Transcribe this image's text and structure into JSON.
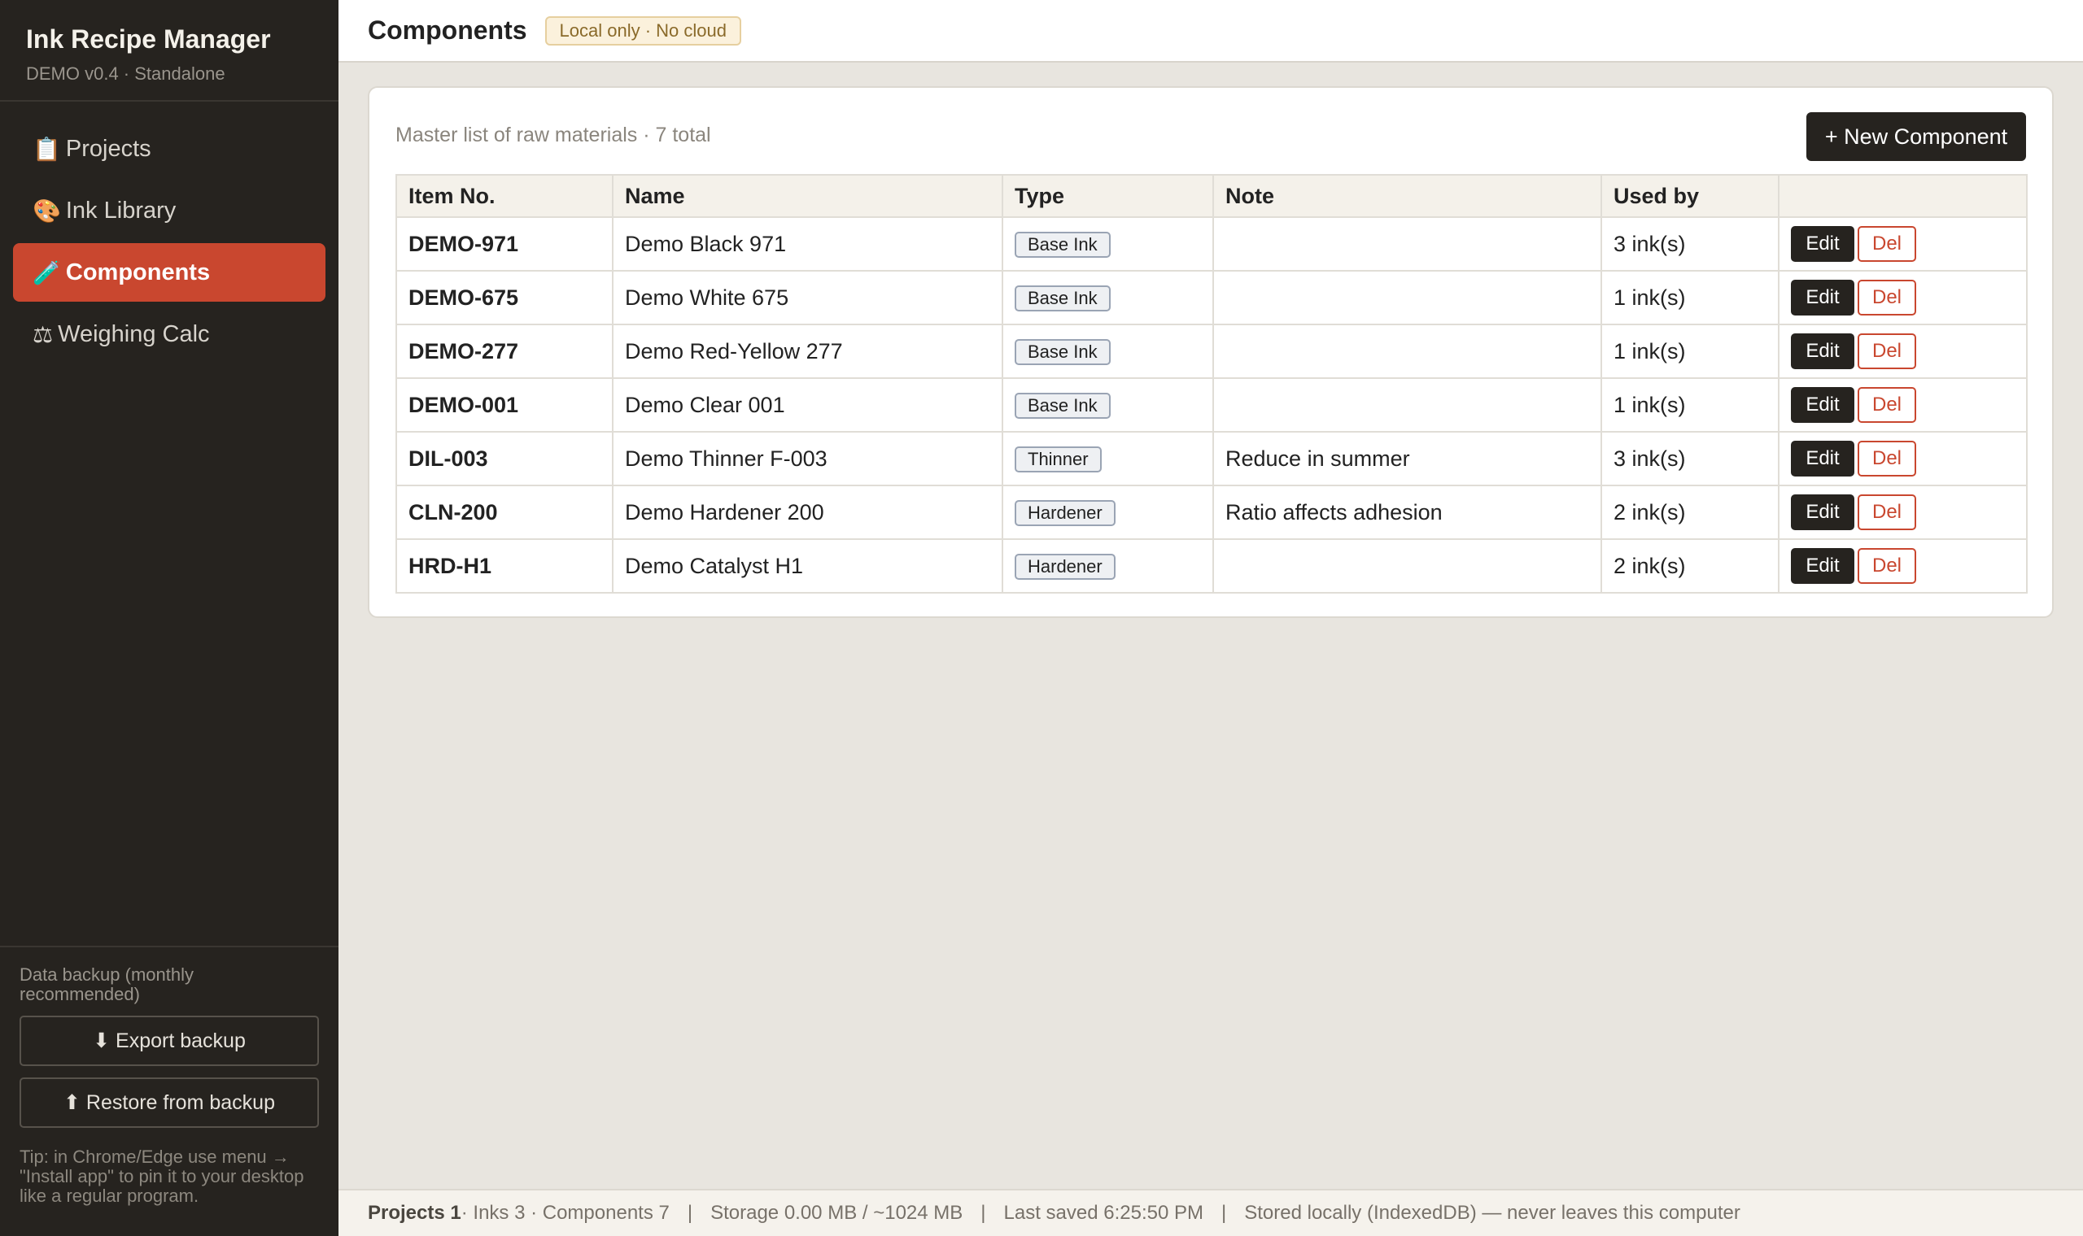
{
  "app": {
    "title": "Ink Recipe Manager",
    "subtitle": "DEMO v0.4 · Standalone"
  },
  "nav": [
    {
      "icon": "📋",
      "icon_name": "clipboard-icon",
      "label": "Projects",
      "active": false
    },
    {
      "icon": "🎨",
      "icon_name": "palette-icon",
      "label": "Ink Library",
      "active": false
    },
    {
      "icon": "🧪",
      "icon_name": "test-tube-icon",
      "label": "Components",
      "active": true
    },
    {
      "icon": "⚖",
      "icon_name": "scales-icon",
      "label": "Weighing Calc",
      "active": false
    }
  ],
  "backup": {
    "label": "Data backup (monthly recommended)",
    "export_label": "⬇ Export backup",
    "restore_label": "⬆ Restore from backup",
    "tip": "Tip: in Chrome/Edge use menu → \"Install app\" to pin it to your desktop like a regular program."
  },
  "header": {
    "title": "Components",
    "badge": "Local only · No cloud"
  },
  "card": {
    "subtitle": "Master list of raw materials · 7 total",
    "new_button": "+ New Component"
  },
  "table": {
    "columns": [
      "Item No.",
      "Name",
      "Type",
      "Note",
      "Used by",
      ""
    ],
    "edit_label": "Edit",
    "del_label": "Del",
    "rows": [
      {
        "item_no": "DEMO-971",
        "name": "Demo Black 971",
        "type": "Base Ink",
        "note": "",
        "used_by": "3 ink(s)"
      },
      {
        "item_no": "DEMO-675",
        "name": "Demo White 675",
        "type": "Base Ink",
        "note": "",
        "used_by": "1 ink(s)"
      },
      {
        "item_no": "DEMO-277",
        "name": "Demo Red-Yellow 277",
        "type": "Base Ink",
        "note": "",
        "used_by": "1 ink(s)"
      },
      {
        "item_no": "DEMO-001",
        "name": "Demo Clear 001",
        "type": "Base Ink",
        "note": "",
        "used_by": "1 ink(s)"
      },
      {
        "item_no": "DIL-003",
        "name": "Demo Thinner F-003",
        "type": "Thinner",
        "note": "Reduce in summer",
        "used_by": "3 ink(s)"
      },
      {
        "item_no": "CLN-200",
        "name": "Demo Hardener 200",
        "type": "Hardener",
        "note": "Ratio affects adhesion",
        "used_by": "2 ink(s)"
      },
      {
        "item_no": "HRD-H1",
        "name": "Demo Catalyst H1",
        "type": "Hardener",
        "note": "",
        "used_by": "2 ink(s)"
      }
    ]
  },
  "status": {
    "projects": "Projects 1",
    "counts": " · Inks 3 · Components 7",
    "separator": "|",
    "storage": "Storage 0.00 MB / ~1024 MB",
    "last_saved": "Last saved 6:25:50 PM",
    "stored": "Stored locally (IndexedDB) — never leaves this computer"
  },
  "colors": {
    "sidebar_bg": "#26231f",
    "accent": "#c9472f",
    "page_bg": "#e8e5df"
  }
}
